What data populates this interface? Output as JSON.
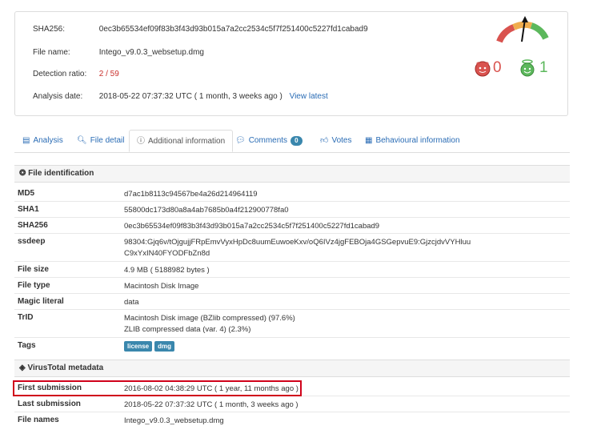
{
  "summary": {
    "sha256_label": "SHA256:",
    "sha256": "0ec3b65534ef09f83b3f43d93b015a7a2cc2534c5f7f251400c5227fd1cabad9",
    "filename_label": "File name:",
    "filename": "Intego_v9.0.3_websetup.dmg",
    "detection_label": "Detection ratio:",
    "detection": "2 / 59",
    "date_label": "Analysis date:",
    "date": "2018-05-22 07:37:32 UTC ( 1 month, 3 weeks ago )",
    "view_latest": "View latest",
    "malicious_votes": "0",
    "harmless_votes": "1"
  },
  "tabs": [
    {
      "label": "Analysis",
      "icon": "table-icon"
    },
    {
      "label": "File detail",
      "icon": "search-icon"
    },
    {
      "label": "Additional information",
      "icon": "info-icon"
    },
    {
      "label": "Comments",
      "icon": "comment-icon",
      "badge": "0"
    },
    {
      "label": "Votes",
      "icon": "thumbs-icon"
    },
    {
      "label": "Behavioural information",
      "icon": "film-icon"
    }
  ],
  "file_identification": {
    "heading": "File identification",
    "rows": [
      {
        "key": "MD5",
        "value": "d7ac1b8113c94567be4a26d214964119"
      },
      {
        "key": "SHA1",
        "value": "55800dc173d80a8a4ab7685b0a4f212900778fa0"
      },
      {
        "key": "SHA256",
        "value": "0ec3b65534ef09f83b3f43d93b015a7a2cc2534c5f7f251400c5227fd1cabad9"
      },
      {
        "key": "ssdeep",
        "value": "98304:Gjq6v/tOjgujjFRpEmvVyxHpDc8uumEuwoeKxv/oQ6IVz4jgFEBOja4GSGepvuE9:GjzcjdvVYHluu",
        "value2": "C9xYxIN40FYODFbZn8d"
      },
      {
        "key": "File size",
        "value": "4.9 MB ( 5188982 bytes )"
      },
      {
        "key": "File type",
        "value": "Macintosh Disk Image"
      },
      {
        "key": "Magic literal",
        "value": "data"
      },
      {
        "key": "TrID",
        "value": "Macintosh Disk image (BZlib compressed) (97.6%)",
        "value2": "ZLIB compressed data (var. 4) (2.3%)"
      },
      {
        "key": "Tags",
        "tags": [
          "license",
          "dmg"
        ]
      }
    ]
  },
  "metadata": {
    "heading": "VirusTotal metadata",
    "rows": [
      {
        "key": "First submission",
        "value": "2016-08-02 04:38:29 UTC ( 1 year, 11 months ago )"
      },
      {
        "key": "Last submission",
        "value": "2018-05-22 07:37:32 UTC ( 1 month, 3 weeks ago )"
      },
      {
        "key": "File names",
        "value": "Intego_v9.0.3_websetup.dmg"
      }
    ]
  },
  "colors": {
    "accent": "#2a6cb5",
    "danger": "#c9302c",
    "success": "#5cb85c",
    "highlight": "#d0021b"
  }
}
